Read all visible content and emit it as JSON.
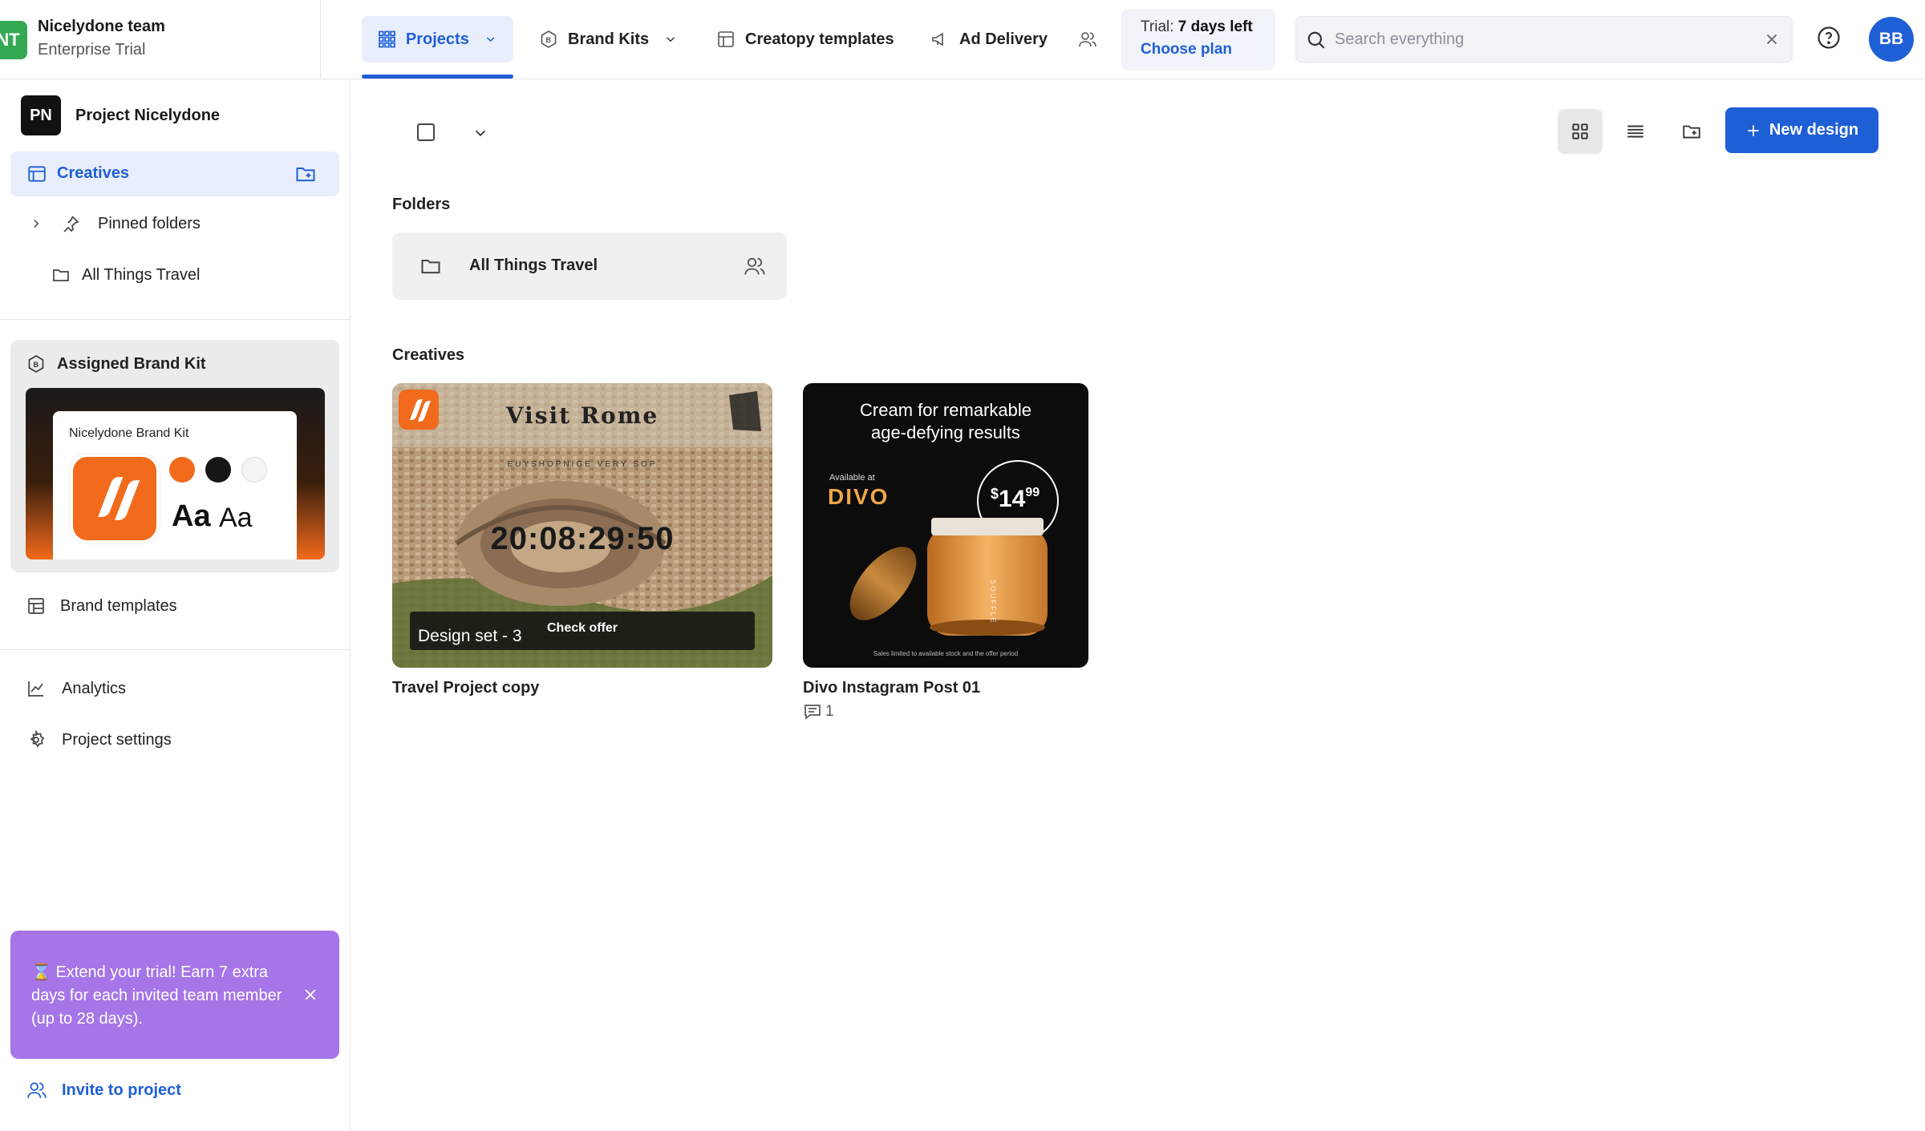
{
  "team": {
    "initials": "NT",
    "name": "Nicelydone team",
    "plan": "Enterprise Trial"
  },
  "nav": {
    "projects": "Projects",
    "brand_kits": "Brand Kits",
    "templates": "Creatopy templates",
    "ad_delivery": "Ad Delivery"
  },
  "trial": {
    "prefix": "Trial: ",
    "days": "7 days left",
    "link": "Choose plan"
  },
  "search": {
    "placeholder": "Search everything"
  },
  "user": {
    "initials": "BB"
  },
  "sidebar": {
    "project_initials": "PN",
    "project_name": "Project Nicelydone",
    "creatives": "Creatives",
    "pinned_folders": "Pinned folders",
    "folder_item": "All Things Travel",
    "assigned_brand_kit": "Assigned Brand Kit",
    "brand_kit_name": "Nicelydone Brand Kit",
    "brand_font_bold": "Aa",
    "brand_font_regular": "Aa",
    "brand_colors": [
      "#f26a1b",
      "#161616",
      "#f4f4f4"
    ],
    "brand_templates": "Brand templates",
    "analytics": "Analytics",
    "project_settings": "Project settings",
    "promo": "⌛ Extend your trial! Earn 7 extra days for each invited team member (up to 28 days).",
    "invite": "Invite to project"
  },
  "main": {
    "new_design": "New design",
    "folders_title": "Folders",
    "folder_name": "All Things Travel",
    "creatives_title": "Creatives",
    "creatives": [
      {
        "name": "Travel Project copy",
        "thumb_title": "Visit Rome",
        "thumb_subtitle": "EUYSHOPNIGE VERY SOP",
        "thumb_timer": "20:08:29:50",
        "thumb_caption": "Design set - 3",
        "thumb_cta": "Check offer"
      },
      {
        "name": "Divo Instagram Post 01",
        "thumb_headline_1": "Cream for remarkable",
        "thumb_headline_2": "age-defying results",
        "thumb_available": "Available at",
        "thumb_brand": "DIVO",
        "thumb_price_currency": "$",
        "thumb_price_main": "14",
        "thumb_price_cents": "99",
        "thumb_jar_text": "SOUFFLE",
        "thumb_footer": "Sales limited to available stock and the offer period",
        "comments": "1"
      }
    ]
  },
  "colors": {
    "accent": "#1f5fd6",
    "promo": "#a675e8",
    "brand_orange": "#f26a1b"
  }
}
